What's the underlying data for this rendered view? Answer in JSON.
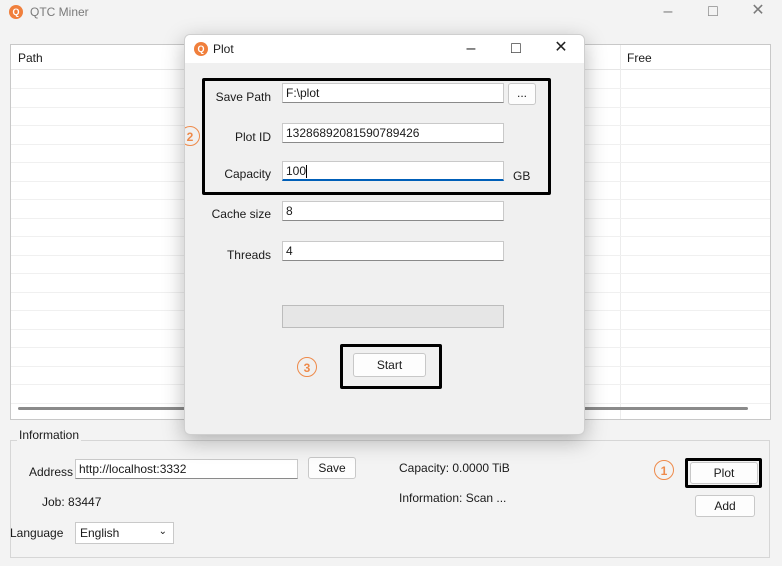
{
  "main": {
    "title": "QTC Miner",
    "table": {
      "columns": [
        "Path",
        "Free"
      ]
    },
    "info": {
      "group_label": "Information",
      "address_label": "Address",
      "address_value": "http://localhost:3332",
      "save_label": "Save",
      "job_text": "Job: 83447",
      "capacity_text": "Capacity: 0.0000 TiB",
      "information_text": "Information: Scan ...",
      "language_label": "Language",
      "language_value": "English",
      "plot_label": "Plot",
      "add_label": "Add"
    }
  },
  "dialog": {
    "title": "Plot",
    "save_path_label": "Save Path",
    "save_path_value": "F:\\plot",
    "browse_label": "...",
    "plot_id_label": "Plot ID",
    "plot_id_value": "13286892081590789426",
    "capacity_label": "Capacity",
    "capacity_value": "100",
    "capacity_unit": "GB",
    "cache_label": "Cache size",
    "cache_value": "8",
    "threads_label": "Threads",
    "threads_value": "4",
    "start_label": "Start",
    "progress": 0
  },
  "annotations": {
    "step1": "1",
    "step2": "2",
    "step3": "3"
  },
  "colors": {
    "accent": "#f07f3c",
    "highlight": "#000000",
    "focus": "#005fb8"
  },
  "icons": {
    "app": "qtc-logo-icon",
    "minimize": "minimize-icon",
    "maximize": "maximize-icon",
    "close": "close-icon"
  }
}
